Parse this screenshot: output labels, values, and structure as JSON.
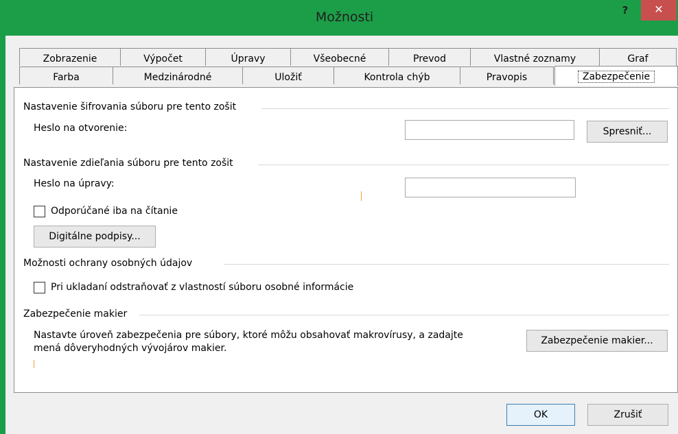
{
  "window": {
    "title": "Možnosti",
    "help_symbol": "?",
    "close_symbol": "✕",
    "accent_color": "#1c9e48",
    "close_color": "#c7504f"
  },
  "tabs_row1": [
    "Zobrazenie",
    "Výpočet",
    "Úpravy",
    "Všeobecné",
    "Prevod",
    "Vlastné zoznamy",
    "Graf"
  ],
  "tabs_row2": [
    "Farba",
    "Medzinárodné",
    "Uložiť",
    "Kontrola chýb",
    "Pravopis",
    "Zabezpečenie"
  ],
  "active_tab": "Zabezpečenie",
  "encryption": {
    "heading": "Nastavenie šifrovania súboru pre tento zošit",
    "open_password_label": "Heslo na otvorenie:",
    "open_password_value": "",
    "advanced_button": "Spresniť..."
  },
  "sharing": {
    "heading": "Nastavenie zdieľania súboru pre tento zošit",
    "modify_password_label": "Heslo na úpravy:",
    "modify_password_value": "",
    "readonly_recommended_label": "Odporúčané iba na čítanie",
    "readonly_recommended_checked": false,
    "digital_signatures_button": "Digitálne podpisy..."
  },
  "privacy": {
    "heading": "Možnosti ochrany osobných údajov",
    "remove_personal_info_label": "Pri ukladaní odstraňovať z vlastností súboru osobné informácie",
    "remove_personal_info_checked": false
  },
  "macro": {
    "heading": "Zabezpečenie makier",
    "description_line1": "Nastavte úroveň zabezpečenia pre súbory, ktoré môžu obsahovať makrovírusy, a zadajte",
    "description_line2": "mená dôveryhodných vývojárov makier.",
    "macro_security_button": "Zabezpečenie makier..."
  },
  "footer": {
    "ok_button": "OK",
    "cancel_button": "Zrušiť"
  }
}
